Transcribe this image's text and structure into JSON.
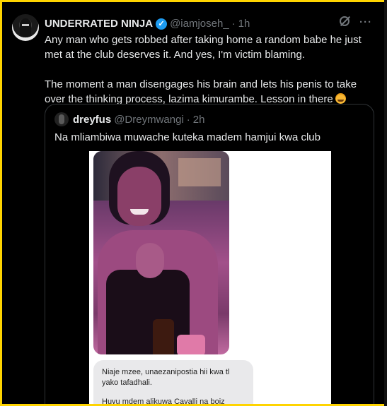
{
  "tweet": {
    "display_name": "UNDERRATED NINJA",
    "handle": "@iamjoseh_",
    "separator": "·",
    "time": "1h",
    "paragraph1": "Any man who gets robbed after taking home a random babe he just met at the club deserves it. And yes, I'm victim blaming.",
    "paragraph2": "The moment a man disengages his brain and lets his penis to take over the thinking process, lazima kimurambe. Lesson in there",
    "emoji": "face-with-tears-of-joy-icon"
  },
  "quote": {
    "display_name": "dreyfus",
    "handle": "@Dreymwangi",
    "separator": "·",
    "time": "2h",
    "text": "Na mliambiwa muwache kuteka madem hamjui kwa club",
    "media": {
      "message_line1": "Niaje mzee, unaezanipostia hii kwa tl yako tafadhali.",
      "message_line2": "Huyu mdem alikuwa Cavalli na boiz"
    }
  },
  "colors": {
    "background": "#000000",
    "text": "#e7e9ea",
    "muted": "#71767b",
    "verified": "#1d9bf0",
    "frame": "#ffd400"
  }
}
